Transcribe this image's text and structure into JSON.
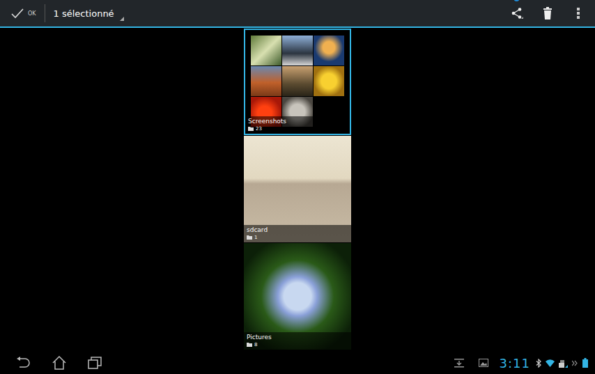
{
  "action_bar": {
    "confirm_label": "OK",
    "selection": "1 sélectionné"
  },
  "albums": [
    {
      "name": "Screenshots",
      "count": "23",
      "selected": true,
      "kind": "grid"
    },
    {
      "name": "sdcard",
      "count": "1",
      "selected": false,
      "kind": "single"
    },
    {
      "name": "Pictures",
      "count": "8",
      "selected": false,
      "kind": "single"
    }
  ],
  "status_bar": {
    "time": "3:11"
  }
}
